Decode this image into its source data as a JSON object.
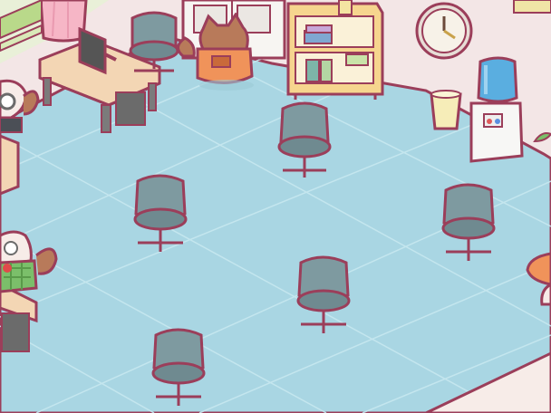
{
  "scene": {
    "title": "",
    "palette": {
      "floor": "#a9d6e3",
      "floor_line": "#c7e8f0",
      "outline": "#9b3e5a",
      "wall": "#f7ece8",
      "chair_seat": "#6f8a90",
      "chair_back": "#7e9aa0",
      "desk": "#f3d6b4",
      "desk_leg": "#7b7b7b",
      "shelf": "#f6d58e",
      "clock_face": "#f7f2e8",
      "cat_orange": "#f0935a",
      "cat_brown": "#b87a5a",
      "water_blue": "#5aaee0",
      "pink_curtain": "#f6b6c6",
      "green_trim": "#b9d98a"
    },
    "objects": [
      {
        "name": "office-chair",
        "count": 8
      },
      {
        "name": "office-desk",
        "count": 2
      },
      {
        "name": "computer-monitor",
        "count": 1
      },
      {
        "name": "bookshelf",
        "count": 1
      },
      {
        "name": "wall-clock",
        "count": 1
      },
      {
        "name": "water-cooler",
        "count": 1
      },
      {
        "name": "trash-bin",
        "count": 1
      },
      {
        "name": "cat-worker",
        "count": 4
      }
    ]
  }
}
